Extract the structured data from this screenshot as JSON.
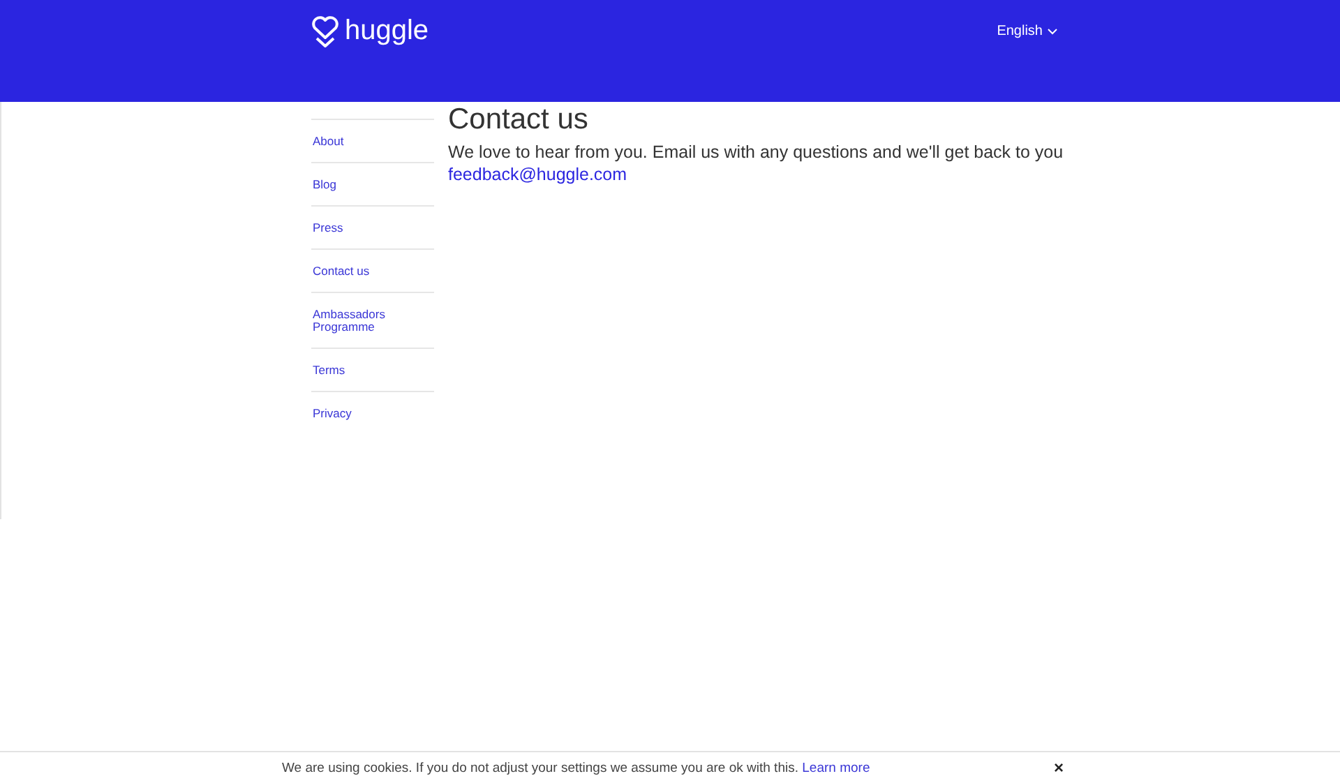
{
  "header": {
    "logo": "huggle",
    "language": "English"
  },
  "sidebar": {
    "items": [
      {
        "label": "About"
      },
      {
        "label": "Blog"
      },
      {
        "label": "Press"
      },
      {
        "label": "Contact us"
      },
      {
        "label": "Ambassadors Programme"
      },
      {
        "label": "Terms"
      },
      {
        "label": "Privacy"
      }
    ]
  },
  "main": {
    "heading": "Contact us",
    "text": "We love to hear from you. Email us with any questions and we'll get back to you",
    "email": "feedback@huggle.com"
  },
  "cookie_bar": {
    "text": "We are using cookies. If you do not adjust your settings we assume you are ok with this.",
    "link": "Learn more",
    "close": "×"
  }
}
